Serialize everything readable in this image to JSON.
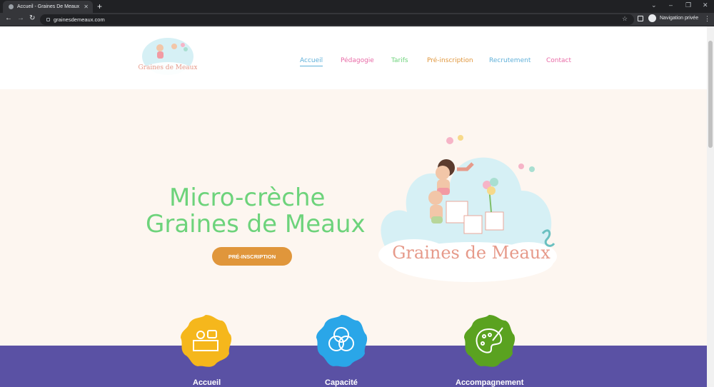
{
  "browser": {
    "tab_title": "Accueil - Graines De Meaux",
    "tab_close": "✕",
    "new_tab": "+",
    "url": "grainesdemeaux.com",
    "profile_label": "Navigation privée",
    "icons": [
      "back-icon",
      "forward-icon",
      "reload-icon",
      "lock-icon",
      "star-icon",
      "sidepanel-icon",
      "incognito-icon",
      "menu-icon"
    ]
  },
  "site": {
    "logo_text": "Graines de Meaux",
    "nav": [
      {
        "label": "Accueil",
        "color": "#5fb0d9"
      },
      {
        "label": "Pédagogie",
        "color": "#e86aa6"
      },
      {
        "label": "Tarifs",
        "color": "#6dd37b"
      },
      {
        "label": "Pré-inscription",
        "color": "#e0963b"
      },
      {
        "label": "Recrutement",
        "color": "#5fb0d9"
      },
      {
        "label": "Contact",
        "color": "#e86aa6"
      }
    ],
    "hero": {
      "title_line1": "Micro-crèche",
      "title_line2": "Graines de Meaux",
      "cta": "PRÉ-INSCRIPTION"
    },
    "features": [
      {
        "label": "Accueil",
        "color": "#f5b71c",
        "icon": "reception-icon"
      },
      {
        "label": "Capacité",
        "color": "#2aa6e8",
        "icon": "circles-icon"
      },
      {
        "label": "Accompagnement",
        "color": "#5aa220",
        "icon": "palette-icon"
      }
    ]
  }
}
